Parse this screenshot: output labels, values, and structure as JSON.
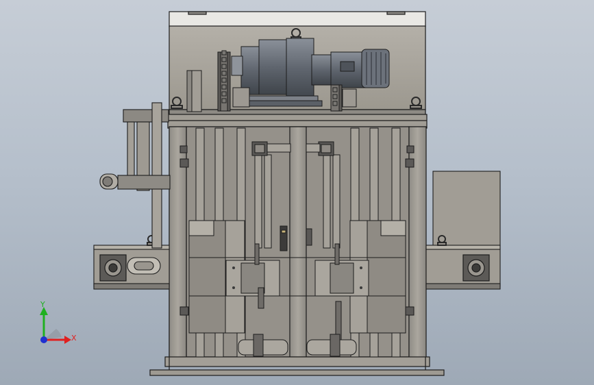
{
  "triad": {
    "x_label": "X",
    "y_label": "Y",
    "x_color": "#e02020",
    "y_color": "#20b020",
    "origin_color": "#2030d0"
  },
  "colors": {
    "background_top": "#c6cdd6",
    "background_bottom": "#9ea9b6",
    "steel_light": "#a7a39a",
    "steel_mid": "#8d8a84",
    "steel_dark": "#5c5b59",
    "motor": "#6f757d",
    "outline": "#1c1c1c"
  },
  "icons": {
    "motor": "gear-motor-icon",
    "sprocket": "sprocket-icon",
    "eye_bolt": "lifting-eye-icon",
    "bearing": "flange-bearing-icon"
  }
}
